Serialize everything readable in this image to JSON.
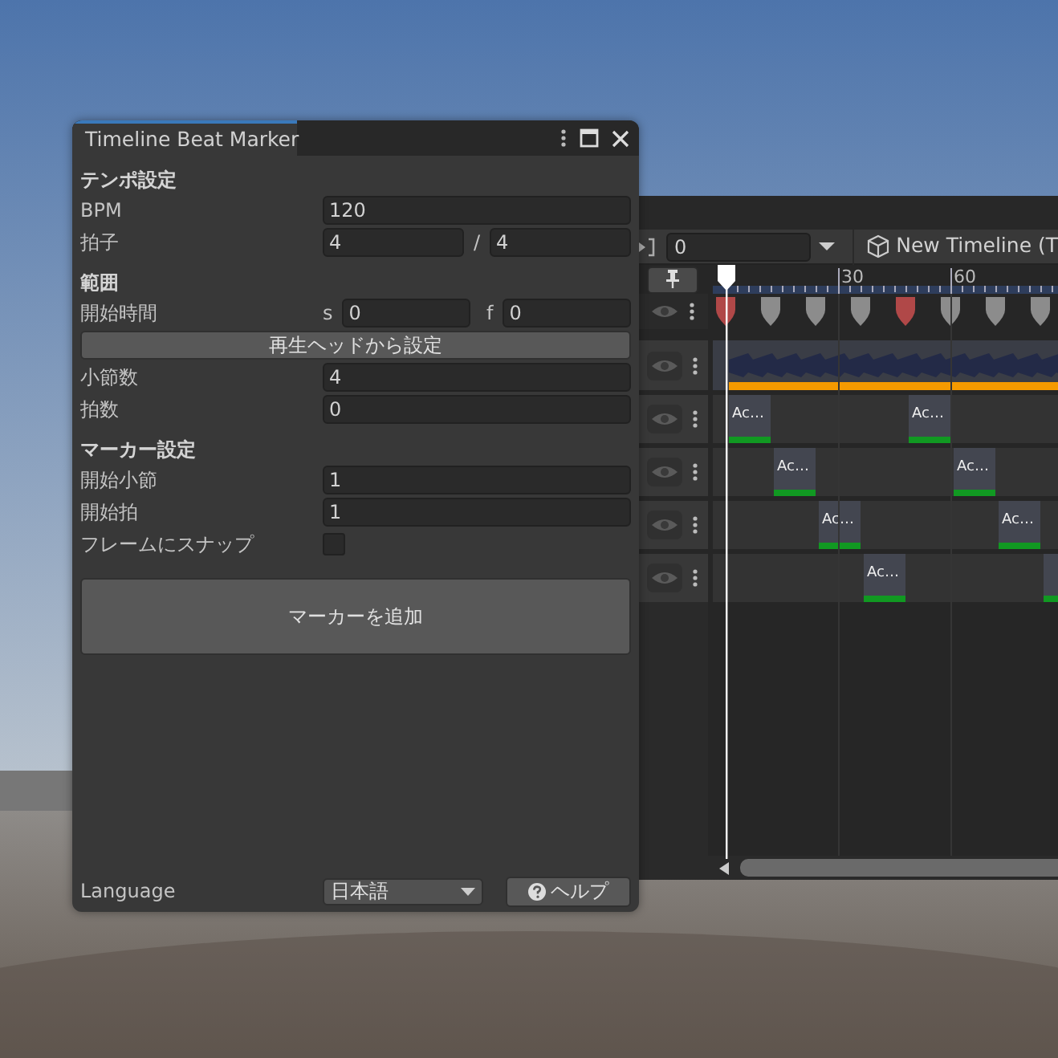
{
  "timeline_window": {
    "toolbar": {
      "frame_field": "0",
      "asset_name": "New Timeline (T"
    },
    "ruler_labels": [
      "30",
      "60"
    ],
    "markers": [
      {
        "highlighted": true
      },
      {
        "highlighted": false
      },
      {
        "highlighted": false
      },
      {
        "highlighted": false
      },
      {
        "highlighted": true
      },
      {
        "highlighted": false
      },
      {
        "highlighted": false
      },
      {
        "highlighted": false
      }
    ],
    "tracks": [
      {
        "kind": "marker"
      },
      {
        "kind": "audio"
      },
      {
        "kind": "activation",
        "clips": [
          {
            "kind": "clip",
            "label": "Ac…"
          },
          {
            "kind": "clip",
            "label": "Ac…"
          }
        ]
      },
      {
        "kind": "activation",
        "clips": [
          {
            "kind": "clip",
            "label": "Ac…"
          },
          {
            "kind": "clip",
            "label": "Ac…"
          }
        ]
      },
      {
        "kind": "activation",
        "clips": [
          {
            "kind": "clip",
            "label": "Ac…"
          },
          {
            "kind": "clip",
            "label": "Ac…"
          }
        ]
      },
      {
        "kind": "activation",
        "clips": [
          {
            "kind": "clip",
            "label": "Ac…"
          },
          {
            "kind": "edge"
          }
        ]
      }
    ]
  },
  "beat_marker_window": {
    "title": "Timeline Beat Marker",
    "sections": [
      {
        "heading": "テンポ設定",
        "rows": [
          {
            "kind": "field",
            "label": "BPM",
            "value": "120"
          },
          {
            "kind": "pair",
            "label": "拍子",
            "separator": "/",
            "parts": [
              {
                "value": "4"
              },
              {
                "value": "4"
              }
            ]
          }
        ]
      },
      {
        "heading": "範囲",
        "rows": [
          {
            "kind": "pair",
            "label": "開始時間",
            "parts": [
              {
                "prefix": "s",
                "value": "0"
              },
              {
                "prefix": "f",
                "value": "0"
              }
            ]
          },
          {
            "kind": "button",
            "label": "再生ヘッドから設定"
          },
          {
            "kind": "field",
            "label": "小節数",
            "value": "4"
          },
          {
            "kind": "field",
            "label": "拍数",
            "value": "0"
          }
        ]
      },
      {
        "heading": "マーカー設定",
        "rows": [
          {
            "kind": "field",
            "label": "開始小節",
            "value": "1"
          },
          {
            "kind": "field",
            "label": "開始拍",
            "value": "1"
          },
          {
            "kind": "checkbox",
            "label": "フレームにスナップ",
            "checked": false
          },
          {
            "kind": "big_button",
            "label": "マーカーを追加"
          }
        ]
      }
    ],
    "footer": {
      "language_label": "Language",
      "language_value": "日本語",
      "help_label": "ヘルプ"
    }
  }
}
